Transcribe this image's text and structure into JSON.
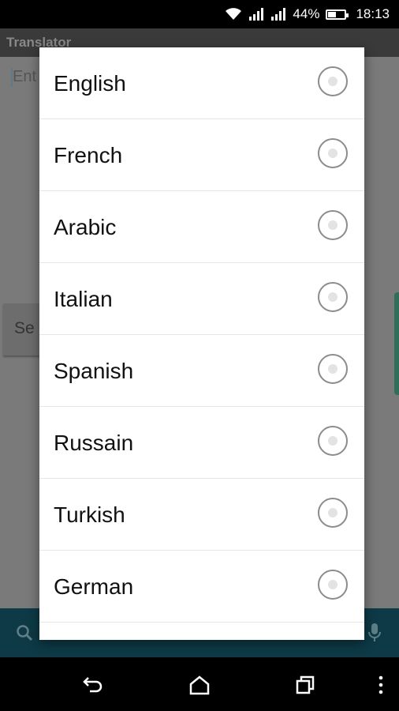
{
  "status_bar": {
    "battery": "44%",
    "time": "18:13"
  },
  "app": {
    "title": "Translator",
    "input_hint": "Ent",
    "select_button": "Se"
  },
  "dialog": {
    "options": [
      {
        "label": "English"
      },
      {
        "label": "French"
      },
      {
        "label": "Arabic"
      },
      {
        "label": "Italian"
      },
      {
        "label": "Spanish"
      },
      {
        "label": "Russain"
      },
      {
        "label": "Turkish"
      },
      {
        "label": "German"
      }
    ]
  },
  "colors": {
    "dialog_bg": "#ffffff",
    "search_bar": "#0d3a46",
    "scrim": "#777777"
  }
}
